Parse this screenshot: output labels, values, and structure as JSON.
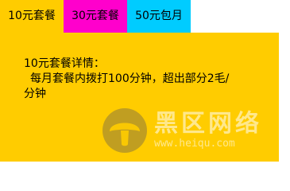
{
  "tabs": [
    {
      "label": "10元套餐",
      "color": "#ffcc00"
    },
    {
      "label": "30元套餐",
      "color": "#ff00cc"
    },
    {
      "label": "50元包月",
      "color": "#00ccff"
    }
  ],
  "panel": {
    "color": "#ffcc00",
    "title": "10元套餐详情：",
    "detail_line1": "每月套餐内拨打100分钟，超出部分2毛/",
    "detail_line2": "分钟"
  },
  "watermark": {
    "name": "黑区网络",
    "url": "www.heiqu.com",
    "icon": "mushroom-logo-icon"
  }
}
